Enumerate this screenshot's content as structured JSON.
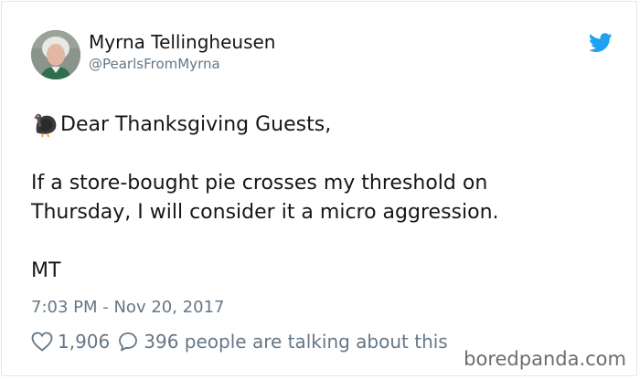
{
  "tweet": {
    "author": {
      "display_name": "Myrna Tellingheusen",
      "handle": "@PearlsFromMyrna",
      "avatar": "avatar-photo"
    },
    "platform_icon": "twitter-bird-icon",
    "emoji": "turkey-emoji",
    "text": {
      "greeting": "Dear Thanksgiving Guests,",
      "line1": "If a store-bought pie crosses my threshold on",
      "line2": "Thursday, I will consider it a micro aggression.",
      "signature": "MT"
    },
    "timestamp": "7:03 PM - Nov 20, 2017",
    "stats": {
      "likes_icon": "heart-icon",
      "likes": "1,906",
      "replies_icon": "speech-bubble-icon",
      "talking": "396 people are talking about this"
    }
  },
  "watermark": "boredpanda.com",
  "colors": {
    "twitter_blue": "#1da1f2",
    "text_primary": "#14171a",
    "text_secondary": "#657786",
    "border": "#e1e8ed"
  }
}
